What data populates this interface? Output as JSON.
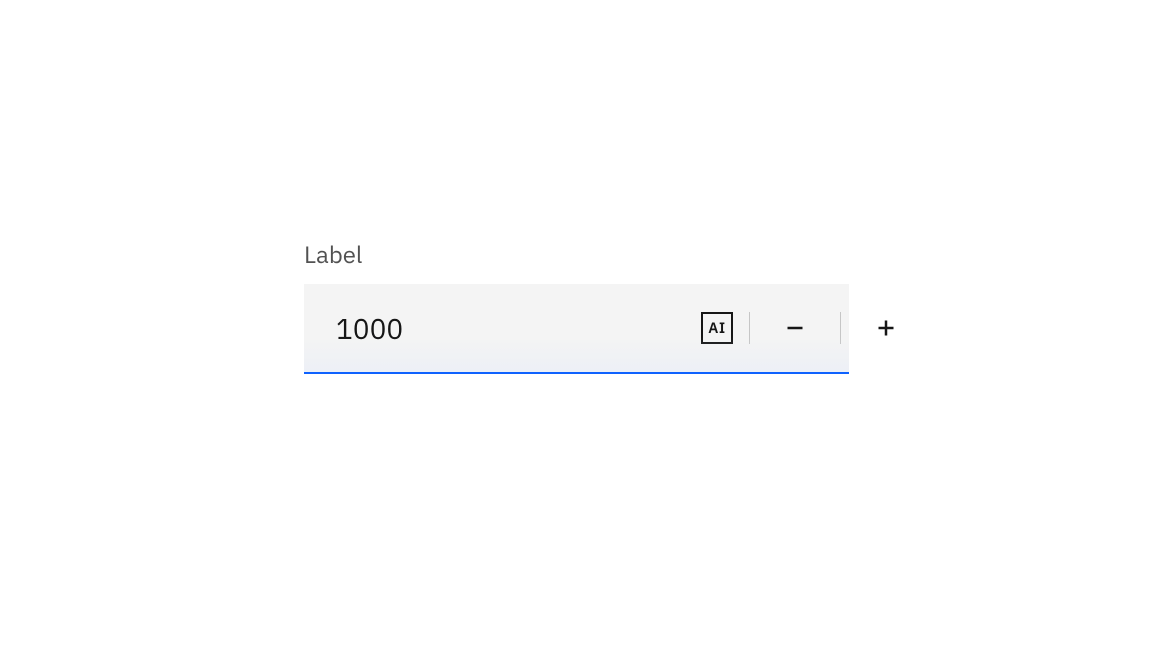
{
  "numberInput": {
    "label": "Label",
    "value": "1000",
    "aiBadge": "AI"
  }
}
